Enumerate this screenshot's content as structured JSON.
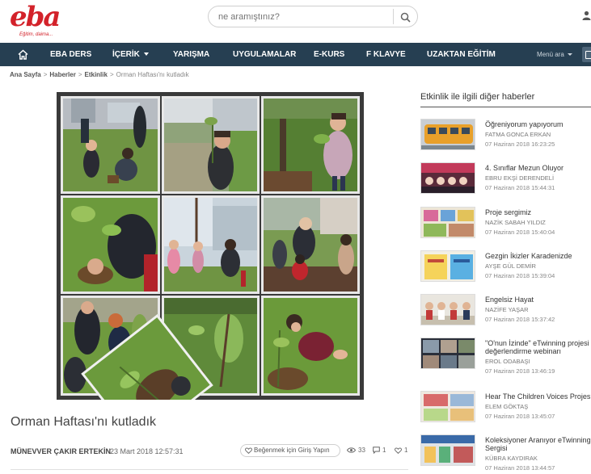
{
  "header": {
    "logo_text": "eba",
    "logo_tagline": "Eğitim, daima...",
    "search_placeholder": "ne aramıştınız?"
  },
  "nav": {
    "items": [
      {
        "label": "EBA DERS",
        "dropdown": false
      },
      {
        "label": "İÇERİK",
        "dropdown": true
      },
      {
        "label": "YARIŞMA",
        "dropdown": false
      },
      {
        "label": "UYGULAMALAR",
        "dropdown": false
      },
      {
        "label": "E-KURS",
        "dropdown": false
      },
      {
        "label": "F KLAVYE",
        "dropdown": false
      },
      {
        "label": "UZAKTAN EĞİTİM",
        "dropdown": false
      }
    ],
    "menu_label": "Menü ara"
  },
  "breadcrumb": {
    "items": [
      "Ana Sayfa",
      "Haberler",
      "Etkinlik"
    ],
    "current": "Orman Haftası'nı kutladık"
  },
  "article": {
    "title": "Orman Haftası'nı kutladık",
    "author": "MÜNEVVER ÇAKIR ERTEKİN",
    "date": "23 Mart 2018 12:57:31",
    "like_button": "Beğenmek için Giriş Yapın",
    "views": "33",
    "comments": "1",
    "likes": "1"
  },
  "sidebar": {
    "title": "Etkinlik ile ilgili diğer haberler",
    "items": [
      {
        "headline": "Öğreniyorum yapıyorum",
        "author": "FATMA GONCA ERKAN",
        "date": "07 Haziran 2018 16:23:25"
      },
      {
        "headline": "4. Sınıflar Mezun Oluyor",
        "author": "EBRU EKŞİ DERENDELİ",
        "date": "07 Haziran 2018 15:44:31"
      },
      {
        "headline": "Proje sergimiz",
        "author": "NAZİK SABAH YILDIZ",
        "date": "07 Haziran 2018 15:40:04"
      },
      {
        "headline": "Gezgin İkizler Karadenizde",
        "author": "AYŞE GÜL DEMİR",
        "date": "07 Haziran 2018 15:39:04"
      },
      {
        "headline": "Engelsiz Hayat",
        "author": "NAZİFE YAŞAR",
        "date": "07 Haziran 2018 15:37:42"
      },
      {
        "headline": "\"O'nun İzinde\" eTwinning projesi değerlendirme webinarı",
        "author": "EROL ODABAŞI",
        "date": "07 Haziran 2018 13:46:19"
      },
      {
        "headline": "Hear The Children Voices Projes",
        "author": "ELEM GÖKTAŞ",
        "date": "07 Haziran 2018 13:45:07"
      },
      {
        "headline": "Koleksiyoner Aranıyor eTwinning Sergisi",
        "author": "KÜBRA KAYDIRAK",
        "date": "07 Haziran 2018 13:44:57"
      }
    ]
  },
  "colors": {
    "brand_red": "#d3222a",
    "navbar": "#263f52",
    "grass": "#5e8a3a"
  }
}
